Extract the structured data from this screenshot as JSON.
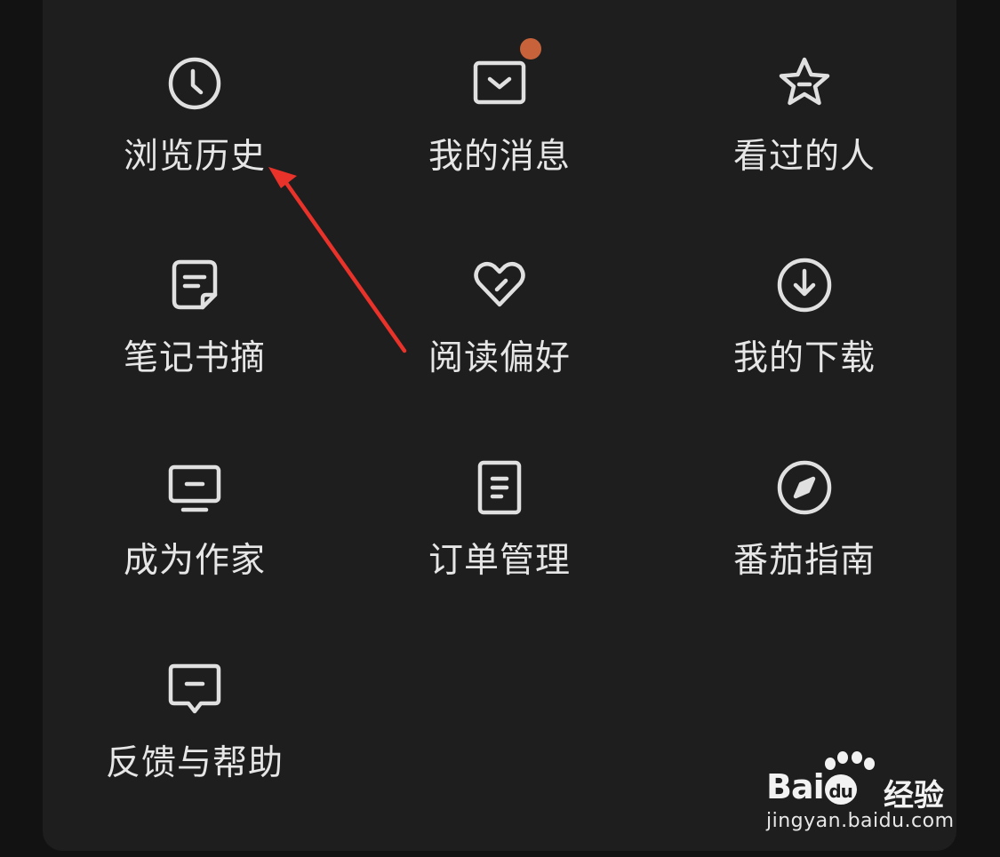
{
  "menu": {
    "items": [
      {
        "label": "浏览历史",
        "icon": "clock-icon"
      },
      {
        "label": "我的消息",
        "icon": "mail-icon",
        "has_badge": true
      },
      {
        "label": "看过的人",
        "icon": "star-icon"
      },
      {
        "label": "笔记书摘",
        "icon": "note-icon"
      },
      {
        "label": "阅读偏好",
        "icon": "heart-icon"
      },
      {
        "label": "我的下载",
        "icon": "download-icon"
      },
      {
        "label": "成为作家",
        "icon": "monitor-icon"
      },
      {
        "label": "订单管理",
        "icon": "document-icon"
      },
      {
        "label": "番茄指南",
        "icon": "compass-icon"
      },
      {
        "label": "反馈与帮助",
        "icon": "feedback-icon"
      }
    ]
  },
  "colors": {
    "background": "#121212",
    "panel": "#1e1e1e",
    "icon_stroke": "#e0e0e0",
    "text": "#e6e6e6",
    "badge": "#c8623a",
    "arrow": "#e8322a"
  },
  "watermark": {
    "logo_text_a": "Bai",
    "logo_text_b": "du",
    "logo_cn": "经验",
    "url": "jingyan.baidu.com"
  }
}
